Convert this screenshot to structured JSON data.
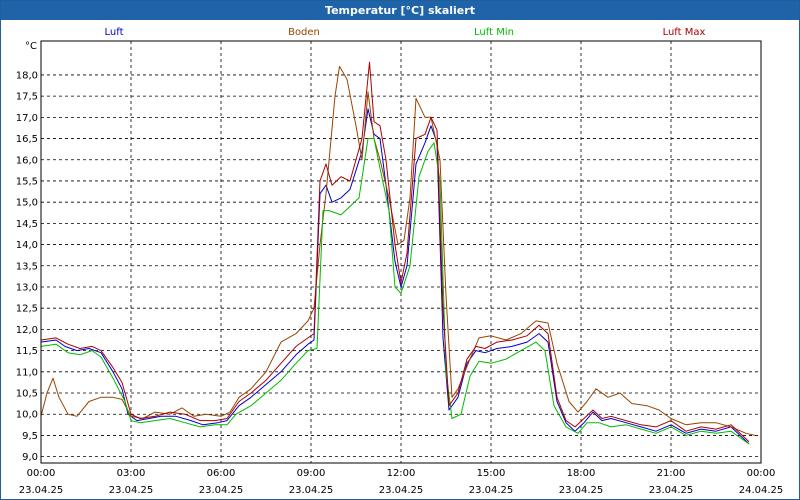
{
  "window": {
    "title": "Temperatur [°C] skaliert"
  },
  "chart_data": {
    "type": "line",
    "ylabel": "°C",
    "ylim": [
      8.85,
      18.8
    ],
    "yticks": [
      9.0,
      9.5,
      10.0,
      10.5,
      11.0,
      11.5,
      12.0,
      12.5,
      13.0,
      13.5,
      14.0,
      14.5,
      15.0,
      15.5,
      16.0,
      16.5,
      17.0,
      17.5,
      18.0
    ],
    "ytick_labels": [
      "9,0",
      "9,5",
      "10,0",
      "10,5",
      "11,0",
      "11,5",
      "12,0",
      "12,5",
      "13,0",
      "13,5",
      "14,0",
      "14,5",
      "15,0",
      "15,5",
      "16,0",
      "16,5",
      "17,0",
      "17,5",
      "18,0"
    ],
    "xlim": [
      0,
      24
    ],
    "xticks": [
      {
        "x": 0,
        "time": "00:00",
        "date": "23.04.25"
      },
      {
        "x": 3,
        "time": "03:00",
        "date": "23.04.25"
      },
      {
        "x": 6,
        "time": "06:00",
        "date": "23.04.25"
      },
      {
        "x": 9,
        "time": "09:00",
        "date": "23.04.25"
      },
      {
        "x": 12,
        "time": "12:00",
        "date": "23.04.25"
      },
      {
        "x": 15,
        "time": "15:00",
        "date": "23.04.25"
      },
      {
        "x": 18,
        "time": "18:00",
        "date": "23.04.25"
      },
      {
        "x": 21,
        "time": "21:00",
        "date": "23.04.25"
      },
      {
        "x": 24,
        "time": "00:00",
        "date": "24.04.25"
      }
    ],
    "grid": true,
    "legend": "top",
    "series": [
      {
        "name": "Luft",
        "color": "#0000cc",
        "points": [
          [
            0,
            11.7
          ],
          [
            0.5,
            11.75
          ],
          [
            0.8,
            11.6
          ],
          [
            1.2,
            11.5
          ],
          [
            1.6,
            11.55
          ],
          [
            2.0,
            11.45
          ],
          [
            2.4,
            11.0
          ],
          [
            2.7,
            10.6
          ],
          [
            2.9,
            10.0
          ],
          [
            3.2,
            9.85
          ],
          [
            3.6,
            9.9
          ],
          [
            4.0,
            9.95
          ],
          [
            4.5,
            9.95
          ],
          [
            5.0,
            9.85
          ],
          [
            5.4,
            9.75
          ],
          [
            5.9,
            9.8
          ],
          [
            6.2,
            9.85
          ],
          [
            6.6,
            10.2
          ],
          [
            7.0,
            10.4
          ],
          [
            7.5,
            10.7
          ],
          [
            8.0,
            11.0
          ],
          [
            8.5,
            11.4
          ],
          [
            8.9,
            11.65
          ],
          [
            9.1,
            11.75
          ],
          [
            9.3,
            15.2
          ],
          [
            9.5,
            15.4
          ],
          [
            9.7,
            15.0
          ],
          [
            10.0,
            15.1
          ],
          [
            10.3,
            15.3
          ],
          [
            10.7,
            16.2
          ],
          [
            10.9,
            17.2
          ],
          [
            11.1,
            16.6
          ],
          [
            11.3,
            16.5
          ],
          [
            11.5,
            15.4
          ],
          [
            11.8,
            13.6
          ],
          [
            12.0,
            13.0
          ],
          [
            12.2,
            13.5
          ],
          [
            12.5,
            15.9
          ],
          [
            12.8,
            16.4
          ],
          [
            13.0,
            16.8
          ],
          [
            13.2,
            16.4
          ],
          [
            13.4,
            11.8
          ],
          [
            13.6,
            10.1
          ],
          [
            13.9,
            10.4
          ],
          [
            14.2,
            11.2
          ],
          [
            14.5,
            11.5
          ],
          [
            14.8,
            11.45
          ],
          [
            15.2,
            11.55
          ],
          [
            15.7,
            11.6
          ],
          [
            16.2,
            11.7
          ],
          [
            16.6,
            11.9
          ],
          [
            16.9,
            11.7
          ],
          [
            17.2,
            10.3
          ],
          [
            17.5,
            9.8
          ],
          [
            17.8,
            9.6
          ],
          [
            18.1,
            9.8
          ],
          [
            18.4,
            10.05
          ],
          [
            18.7,
            9.85
          ],
          [
            19.0,
            9.9
          ],
          [
            19.5,
            9.8
          ],
          [
            20.0,
            9.7
          ],
          [
            20.5,
            9.6
          ],
          [
            21.0,
            9.75
          ],
          [
            21.5,
            9.55
          ],
          [
            22.0,
            9.65
          ],
          [
            22.5,
            9.6
          ],
          [
            23.0,
            9.7
          ],
          [
            23.3,
            9.5
          ],
          [
            23.6,
            9.3
          ]
        ]
      },
      {
        "name": "Boden",
        "color": "#994400",
        "points": [
          [
            0,
            9.95
          ],
          [
            0.2,
            10.5
          ],
          [
            0.4,
            10.85
          ],
          [
            0.6,
            10.4
          ],
          [
            0.9,
            10.0
          ],
          [
            1.2,
            9.95
          ],
          [
            1.6,
            10.3
          ],
          [
            2.0,
            10.4
          ],
          [
            2.4,
            10.4
          ],
          [
            2.7,
            10.35
          ],
          [
            3.0,
            9.95
          ],
          [
            3.4,
            9.9
          ],
          [
            3.8,
            10.05
          ],
          [
            4.3,
            10.0
          ],
          [
            4.7,
            10.15
          ],
          [
            5.1,
            9.95
          ],
          [
            5.5,
            10.0
          ],
          [
            6.0,
            9.95
          ],
          [
            6.3,
            10.05
          ],
          [
            6.6,
            10.4
          ],
          [
            7.0,
            10.6
          ],
          [
            7.5,
            11.0
          ],
          [
            8.0,
            11.7
          ],
          [
            8.5,
            11.9
          ],
          [
            8.9,
            12.2
          ],
          [
            9.1,
            12.5
          ],
          [
            9.3,
            14.0
          ],
          [
            9.5,
            15.2
          ],
          [
            9.8,
            17.5
          ],
          [
            9.95,
            18.2
          ],
          [
            10.2,
            17.9
          ],
          [
            10.5,
            16.8
          ],
          [
            10.7,
            16.0
          ],
          [
            10.9,
            17.6
          ],
          [
            11.1,
            16.5
          ],
          [
            11.3,
            16.0
          ],
          [
            11.6,
            15.1
          ],
          [
            11.9,
            14.0
          ],
          [
            12.1,
            14.1
          ],
          [
            12.3,
            15.1
          ],
          [
            12.5,
            17.45
          ],
          [
            12.8,
            17.0
          ],
          [
            13.0,
            17.0
          ],
          [
            13.3,
            16.0
          ],
          [
            13.5,
            12.8
          ],
          [
            13.7,
            10.4
          ],
          [
            13.9,
            10.6
          ],
          [
            14.3,
            11.3
          ],
          [
            14.6,
            11.8
          ],
          [
            15.0,
            11.85
          ],
          [
            15.5,
            11.75
          ],
          [
            16.0,
            11.9
          ],
          [
            16.5,
            12.2
          ],
          [
            16.9,
            12.15
          ],
          [
            17.2,
            11.2
          ],
          [
            17.6,
            10.3
          ],
          [
            17.9,
            10.05
          ],
          [
            18.2,
            10.3
          ],
          [
            18.5,
            10.6
          ],
          [
            18.9,
            10.4
          ],
          [
            19.3,
            10.5
          ],
          [
            19.7,
            10.25
          ],
          [
            20.2,
            10.2
          ],
          [
            20.6,
            10.1
          ],
          [
            21.0,
            9.9
          ],
          [
            21.5,
            9.75
          ],
          [
            22.0,
            9.8
          ],
          [
            22.5,
            9.8
          ],
          [
            23.0,
            9.7
          ],
          [
            23.5,
            9.55
          ],
          [
            23.8,
            9.5
          ]
        ]
      },
      {
        "name": "Luft Min",
        "color": "#00bb00",
        "points": [
          [
            0,
            11.6
          ],
          [
            0.5,
            11.65
          ],
          [
            0.9,
            11.45
          ],
          [
            1.3,
            11.4
          ],
          [
            1.7,
            11.5
          ],
          [
            2.0,
            11.35
          ],
          [
            2.4,
            10.85
          ],
          [
            2.8,
            10.3
          ],
          [
            3.0,
            9.85
          ],
          [
            3.3,
            9.8
          ],
          [
            3.8,
            9.85
          ],
          [
            4.3,
            9.9
          ],
          [
            4.8,
            9.8
          ],
          [
            5.3,
            9.7
          ],
          [
            5.8,
            9.75
          ],
          [
            6.2,
            9.75
          ],
          [
            6.5,
            10.0
          ],
          [
            7.0,
            10.2
          ],
          [
            7.5,
            10.5
          ],
          [
            8.0,
            10.8
          ],
          [
            8.5,
            11.2
          ],
          [
            8.9,
            11.5
          ],
          [
            9.2,
            11.55
          ],
          [
            9.4,
            14.8
          ],
          [
            9.6,
            14.8
          ],
          [
            10.0,
            14.7
          ],
          [
            10.3,
            14.9
          ],
          [
            10.6,
            15.1
          ],
          [
            10.9,
            16.5
          ],
          [
            11.1,
            16.5
          ],
          [
            11.3,
            15.8
          ],
          [
            11.6,
            14.8
          ],
          [
            11.8,
            13.0
          ],
          [
            12.0,
            12.85
          ],
          [
            12.3,
            13.5
          ],
          [
            12.6,
            15.6
          ],
          [
            12.9,
            16.2
          ],
          [
            13.1,
            16.4
          ],
          [
            13.3,
            15.5
          ],
          [
            13.5,
            11.0
          ],
          [
            13.7,
            9.9
          ],
          [
            14.0,
            10.0
          ],
          [
            14.3,
            10.9
          ],
          [
            14.6,
            11.25
          ],
          [
            15.0,
            11.2
          ],
          [
            15.5,
            11.3
          ],
          [
            16.0,
            11.5
          ],
          [
            16.5,
            11.7
          ],
          [
            16.8,
            11.5
          ],
          [
            17.1,
            10.2
          ],
          [
            17.5,
            9.7
          ],
          [
            17.9,
            9.55
          ],
          [
            18.2,
            9.8
          ],
          [
            18.6,
            9.8
          ],
          [
            19.0,
            9.7
          ],
          [
            19.5,
            9.75
          ],
          [
            20.0,
            9.65
          ],
          [
            20.5,
            9.55
          ],
          [
            21.0,
            9.7
          ],
          [
            21.5,
            9.5
          ],
          [
            22.0,
            9.6
          ],
          [
            22.5,
            9.55
          ],
          [
            23.0,
            9.6
          ],
          [
            23.3,
            9.45
          ],
          [
            23.6,
            9.3
          ]
        ]
      },
      {
        "name": "Luft Max",
        "color": "#aa0000",
        "points": [
          [
            0,
            11.75
          ],
          [
            0.5,
            11.8
          ],
          [
            0.9,
            11.65
          ],
          [
            1.3,
            11.55
          ],
          [
            1.7,
            11.6
          ],
          [
            2.0,
            11.5
          ],
          [
            2.4,
            11.1
          ],
          [
            2.7,
            10.75
          ],
          [
            3.0,
            10.0
          ],
          [
            3.3,
            9.9
          ],
          [
            3.8,
            9.95
          ],
          [
            4.3,
            10.05
          ],
          [
            4.8,
            10.0
          ],
          [
            5.3,
            9.85
          ],
          [
            5.8,
            9.85
          ],
          [
            6.2,
            9.9
          ],
          [
            6.6,
            10.3
          ],
          [
            7.0,
            10.5
          ],
          [
            7.5,
            10.8
          ],
          [
            8.0,
            11.2
          ],
          [
            8.5,
            11.6
          ],
          [
            8.9,
            11.8
          ],
          [
            9.1,
            11.9
          ],
          [
            9.3,
            15.5
          ],
          [
            9.5,
            15.9
          ],
          [
            9.7,
            15.4
          ],
          [
            10.0,
            15.6
          ],
          [
            10.3,
            15.5
          ],
          [
            10.7,
            16.5
          ],
          [
            10.95,
            18.3
          ],
          [
            11.1,
            16.9
          ],
          [
            11.3,
            16.8
          ],
          [
            11.5,
            16.0
          ],
          [
            11.8,
            14.0
          ],
          [
            12.0,
            13.1
          ],
          [
            12.2,
            13.8
          ],
          [
            12.5,
            16.5
          ],
          [
            12.8,
            16.6
          ],
          [
            13.0,
            17.0
          ],
          [
            13.2,
            16.7
          ],
          [
            13.4,
            12.5
          ],
          [
            13.6,
            10.2
          ],
          [
            13.9,
            10.5
          ],
          [
            14.2,
            11.3
          ],
          [
            14.5,
            11.6
          ],
          [
            14.8,
            11.55
          ],
          [
            15.2,
            11.7
          ],
          [
            15.7,
            11.75
          ],
          [
            16.2,
            11.85
          ],
          [
            16.6,
            12.1
          ],
          [
            16.9,
            11.9
          ],
          [
            17.2,
            10.4
          ],
          [
            17.5,
            9.85
          ],
          [
            17.8,
            9.7
          ],
          [
            18.1,
            9.9
          ],
          [
            18.4,
            10.1
          ],
          [
            18.7,
            9.9
          ],
          [
            19.0,
            9.95
          ],
          [
            19.5,
            9.85
          ],
          [
            20.0,
            9.75
          ],
          [
            20.5,
            9.7
          ],
          [
            21.0,
            9.85
          ],
          [
            21.5,
            9.6
          ],
          [
            22.0,
            9.7
          ],
          [
            22.5,
            9.65
          ],
          [
            23.0,
            9.75
          ],
          [
            23.3,
            9.55
          ],
          [
            23.6,
            9.35
          ]
        ]
      }
    ]
  }
}
